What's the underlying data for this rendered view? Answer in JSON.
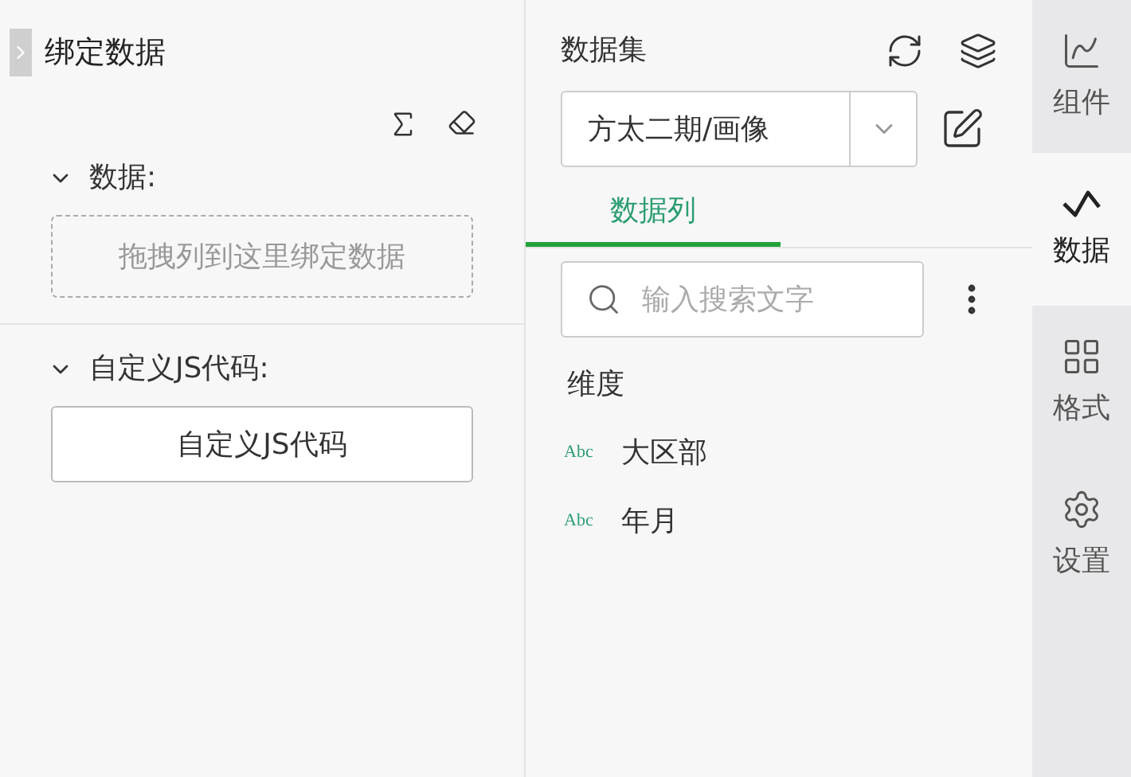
{
  "bind_panel": {
    "title": "绑定数据",
    "sections": [
      {
        "label": "数据:",
        "expanded": true,
        "kind": "drop",
        "text": "拖拽列到这里绑定数据"
      },
      {
        "label": "自定义JS代码:",
        "expanded": true,
        "kind": "button",
        "text": "自定义JS代码"
      }
    ]
  },
  "dataset_panel": {
    "title": "数据集",
    "dataset": "方太二期/画像",
    "tabs": [
      {
        "label": "数据列",
        "selected": true
      }
    ],
    "search": {
      "placeholder": "输入搜索文字"
    },
    "group": "维度",
    "fields": [
      {
        "type": "Abc",
        "name": "大区部"
      },
      {
        "type": "Abc",
        "name": "年月"
      }
    ]
  },
  "sidebar": {
    "items": [
      {
        "label": "组件",
        "kind": "component",
        "selected": false
      },
      {
        "label": "数据",
        "kind": "data",
        "selected": true
      },
      {
        "label": "格式",
        "kind": "format",
        "selected": false
      },
      {
        "label": "设置",
        "kind": "settings",
        "selected": false
      }
    ]
  }
}
